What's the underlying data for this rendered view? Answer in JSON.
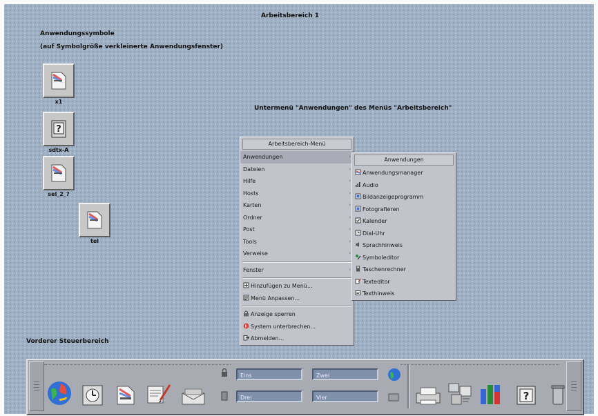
{
  "captions": {
    "workspace_title": "Arbeitsbereich 1",
    "icons_heading": "Anwendungssymbole",
    "icons_subheading": "(auf Symbolgröße verkleinerte Anwendungsfenster)",
    "submenu_caption": "Untermenü \"Anwendungen\" des Menüs \"Arbeitsbereich\"",
    "panel_caption": "Vorderer Steuerbereich"
  },
  "desktop_icons": [
    {
      "label": "x1"
    },
    {
      "label": "sdtx-A"
    },
    {
      "label": "sel_2_?"
    },
    {
      "label": "tel"
    }
  ],
  "workspace_menu": {
    "title": "Arbeitsbereich-Menü",
    "groups": [
      [
        {
          "label": "Anwendungen",
          "submenu": true,
          "highlighted": true
        },
        {
          "label": "Dateien",
          "submenu": true
        },
        {
          "label": "Hilfe",
          "submenu": true
        },
        {
          "label": "Hosts",
          "submenu": true
        },
        {
          "label": "Karten",
          "submenu": true
        },
        {
          "label": "Ordner",
          "submenu": true
        },
        {
          "label": "Post",
          "submenu": true
        },
        {
          "label": "Tools",
          "submenu": true
        },
        {
          "label": "Verweise",
          "submenu": true
        }
      ],
      [
        {
          "label": "Fenster",
          "submenu": true
        }
      ],
      [
        {
          "label": "Hinzufügen zu Menü...",
          "icon": "add-to-menu-icon"
        },
        {
          "label": "Menü Anpassen...",
          "icon": "customize-menu-icon"
        }
      ],
      [
        {
          "label": "Anzeige sperren",
          "icon": "lock-screen-icon"
        },
        {
          "label": "System unterbrechen...",
          "icon": "suspend-system-icon"
        },
        {
          "label": "Abmelden...",
          "icon": "logout-icon"
        }
      ]
    ]
  },
  "applications_menu": {
    "title": "Anwendungen",
    "items": [
      {
        "label": "Anwendungsmanager",
        "icon": "app-manager-icon"
      },
      {
        "label": "Audio",
        "icon": "audio-icon"
      },
      {
        "label": "Bildanzeigeprogramm",
        "icon": "image-viewer-icon"
      },
      {
        "label": "Fotografieren",
        "icon": "snapshot-icon"
      },
      {
        "label": "Kalender",
        "icon": "calendar-icon"
      },
      {
        "label": "Dial-Uhr",
        "icon": "clock-icon"
      },
      {
        "label": "Sprachhinweis",
        "icon": "voice-note-icon"
      },
      {
        "label": "Symboleditor",
        "icon": "icon-editor-icon"
      },
      {
        "label": "Taschenrechner",
        "icon": "calculator-icon"
      },
      {
        "label": "Texteditor",
        "icon": "text-editor-icon"
      },
      {
        "label": "Texthinweis",
        "icon": "text-note-icon"
      }
    ]
  },
  "front_panel": {
    "workspaces": [
      "Eins",
      "Zwei",
      "Drei",
      "Vier"
    ],
    "left_icons": [
      "globe-icon",
      "clock-icon",
      "file-manager-icon",
      "text-editor-icon",
      "mailer-icon"
    ],
    "right_icons": [
      "printer-icon",
      "style-manager-icon",
      "performance-meter-icon",
      "help-icon",
      "trash-icon"
    ],
    "colors": {
      "workspace_button": "#7f90ab",
      "desktop": "#9fb0c4",
      "menu": "#c2c4cc"
    }
  }
}
